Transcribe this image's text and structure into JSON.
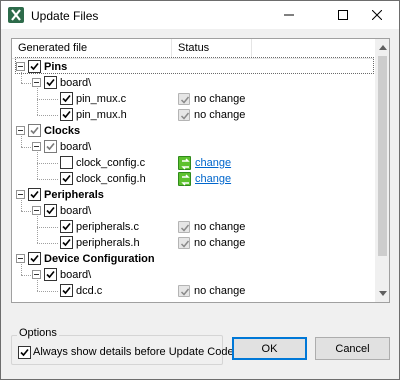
{
  "window": {
    "title": "Update Files",
    "icon": "app-x-logo-icon"
  },
  "tree": {
    "columns": [
      "Generated file",
      "Status"
    ],
    "groups": [
      {
        "label": "Pins",
        "checked": true,
        "folder": "board\\",
        "folder_checked": true,
        "files": [
          {
            "name": "pin_mux.c",
            "checked": true,
            "status": "no change",
            "status_type": "nochange"
          },
          {
            "name": "pin_mux.h",
            "checked": true,
            "status": "no change",
            "status_type": "nochange"
          }
        ]
      },
      {
        "label": "Clocks",
        "checked": "partial",
        "folder": "board\\",
        "folder_checked": "partial",
        "files": [
          {
            "name": "clock_config.c",
            "checked": false,
            "status": "change",
            "status_type": "change"
          },
          {
            "name": "clock_config.h",
            "checked": true,
            "status": "change",
            "status_type": "change"
          }
        ]
      },
      {
        "label": "Peripherals",
        "checked": true,
        "folder": "board\\",
        "folder_checked": true,
        "files": [
          {
            "name": "peripherals.c",
            "checked": true,
            "status": "no change",
            "status_type": "nochange"
          },
          {
            "name": "peripherals.h",
            "checked": true,
            "status": "no change",
            "status_type": "nochange"
          }
        ]
      },
      {
        "label": "Device Configuration",
        "checked": true,
        "folder": "board\\",
        "folder_checked": true,
        "files": [
          {
            "name": "dcd.c",
            "checked": true,
            "status": "no change",
            "status_type": "nochange"
          }
        ]
      }
    ]
  },
  "options": {
    "title": "Options",
    "always_show_label": "Always show details before Update Code",
    "always_show_checked": true
  },
  "buttons": {
    "ok": "OK",
    "cancel": "Cancel"
  },
  "colors": {
    "link": "#0066cc",
    "change_icon": "#5dc12e",
    "focus_border": "#0078d7"
  }
}
